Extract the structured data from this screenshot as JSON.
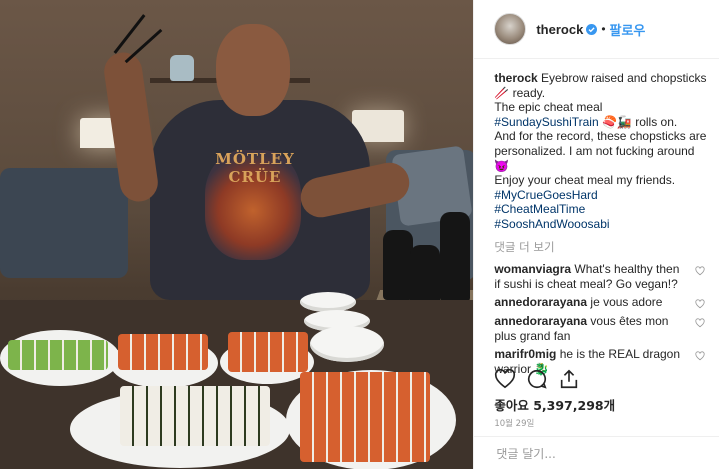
{
  "header": {
    "username": "therock",
    "separator": "•",
    "follow_label": "팔로우"
  },
  "caption": {
    "username": "therock",
    "line1": "Eyebrow raised and chopsticks 🥢 ready.",
    "line2_pre": "The epic cheat meal ",
    "line2_tag": "#SundaySushiTrain",
    "line2_post": " 🍣🚂 rolls on.",
    "line3": "And for the record, these chopsticks are personalized. I am not fucking around 😈",
    "line4": "Enjoy your cheat meal my friends.",
    "hashtags": [
      "#MyCrueGoesHard",
      "#CheatMealTime",
      "#SooshAndWooosabi"
    ]
  },
  "view_more": "댓글 더 보기",
  "comments": [
    {
      "user": "womanviagra",
      "text": "What's healthy then if sushi is cheat meal? Go vegan!?"
    },
    {
      "user": "annedorarayana",
      "text": "je vous adore"
    },
    {
      "user": "annedorarayana",
      "text": "vous êtes mon plus grand fan"
    },
    {
      "user": "marifr0mig",
      "text": "he is the REAL dragon warrior 🐉"
    }
  ],
  "likes": {
    "label": "좋아요",
    "count": "5,397,298개"
  },
  "date": "10월 29일",
  "add_comment_placeholder": "댓글 달기...",
  "photo": {
    "shirt_text": "MÖTLEY CRÜE"
  },
  "colors": {
    "accent": "#3897f0",
    "hashtag": "#003569",
    "muted": "#999999",
    "text": "#262626"
  },
  "icons": [
    "verified-badge-icon",
    "heart-icon",
    "comment-icon",
    "share-icon",
    "bookmark-icon",
    "small-heart-icon"
  ]
}
